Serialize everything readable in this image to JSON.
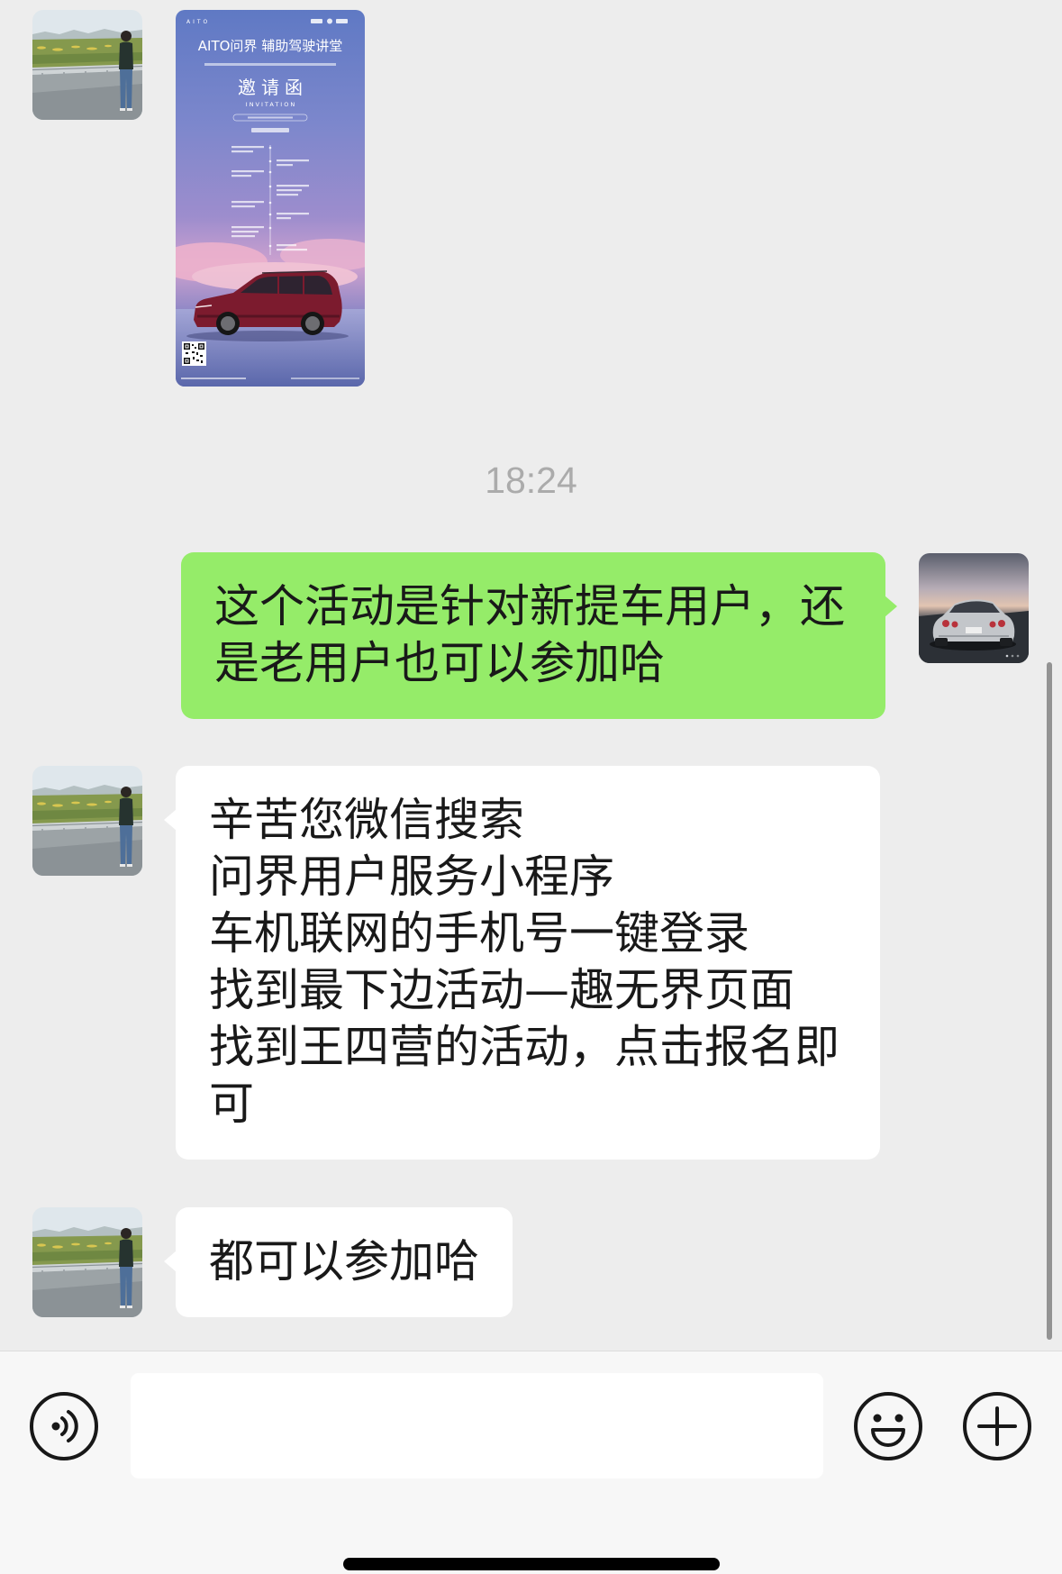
{
  "colors": {
    "chat_background": "#ededed",
    "input_bar_background": "#f7f7f7",
    "outgoing_bubble": "#95ec69",
    "incoming_bubble": "#ffffff",
    "message_text": "#191919",
    "timestamp_text": "#ababab"
  },
  "conversation": {
    "invitation_image": {
      "brand_mark": "AITO",
      "title": "AITO问界 辅助驾驶讲堂",
      "heading": "邀请函",
      "heading_en": "INVITATION"
    },
    "timestamp": "18:24",
    "outgoing_message": {
      "text": "这个活动是针对新提车用户，还是老用户也可以参加哈"
    },
    "incoming_message_1": {
      "lines": [
        "辛苦您微信搜索",
        "问界用户服务小程序",
        "车机联网的手机号一键登录",
        "找到最下边活动—趣无界页面",
        "找到王四营的活动，点击报名即可"
      ]
    },
    "incoming_message_2": {
      "text": "都可以参加哈"
    }
  },
  "input_bar": {
    "voice_button_icon": "voice-icon",
    "message_input_value": "",
    "emoji_button_icon": "emoji-icon",
    "more_button_icon": "plus-icon"
  }
}
